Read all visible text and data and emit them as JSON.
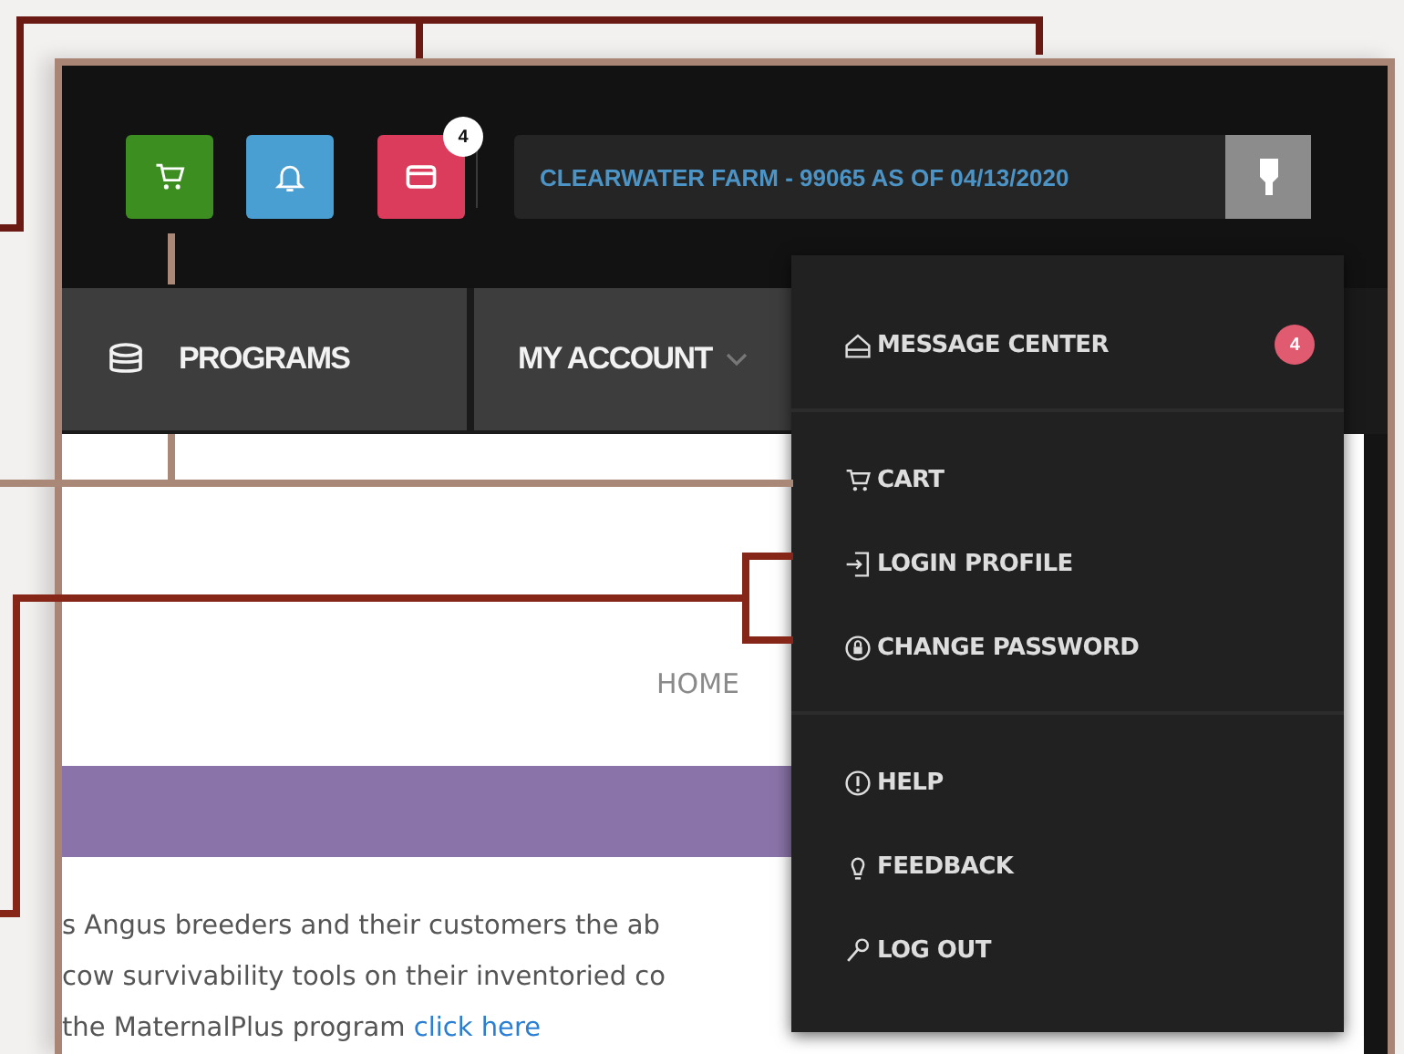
{
  "header": {
    "icons": [
      {
        "kind": "cart",
        "color": "#3b8e1f"
      },
      {
        "kind": "bell",
        "color": "#4a9fd2"
      },
      {
        "kind": "mail",
        "color": "#dc3c5c",
        "badge": "4"
      }
    ],
    "account": "CLEARWATER FARM - 99065 AS OF 04/13/2020"
  },
  "nav": {
    "tabs": [
      {
        "label": "PROGRAMS",
        "kind": "stack"
      },
      {
        "label": "MY ACCOUNT",
        "kind": "caret"
      }
    ]
  },
  "breadcrumb": "HOME",
  "intro": {
    "lines": [
      "s Angus breeders and their customers the ab",
      "cow survivability tools on their inventoried co",
      "the MaternalPlus program"
    ],
    "link": "click here"
  },
  "menu": {
    "sections": [
      [
        {
          "kind": "home",
          "label": "MESSAGE CENTER",
          "badge": "4"
        }
      ],
      [
        {
          "kind": "cart",
          "label": "CART"
        },
        {
          "kind": "login",
          "label": "LOGIN PROFILE"
        },
        {
          "kind": "lock",
          "label": "CHANGE PASSWORD"
        }
      ],
      [
        {
          "kind": "help",
          "label": "HELP"
        },
        {
          "kind": "bulb",
          "label": "FEEDBACK"
        },
        {
          "kind": "key",
          "label": "LOG OUT"
        }
      ]
    ]
  }
}
